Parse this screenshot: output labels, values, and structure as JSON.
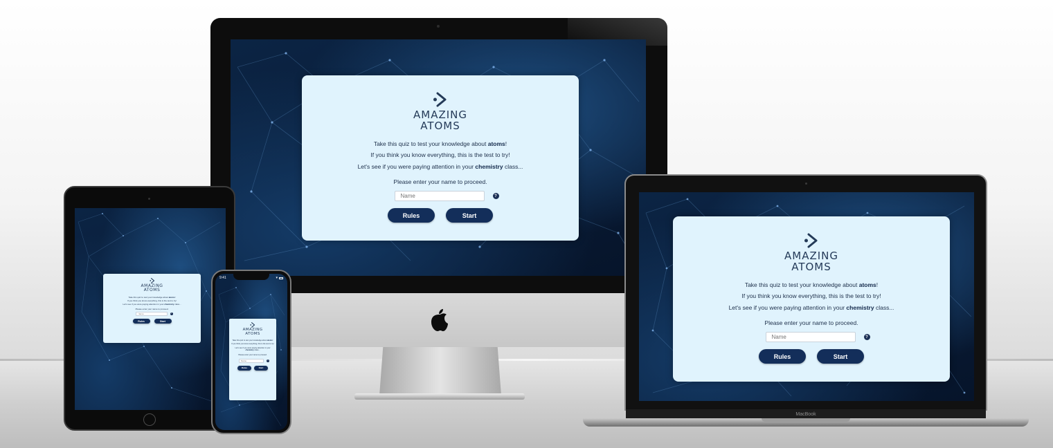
{
  "app": {
    "logo_line1": "AMAZING",
    "logo_line2": "ATOMS",
    "intro_1_before": "Take this quiz to test your knowledge about ",
    "intro_1_bold": "atoms",
    "intro_1_after": "!",
    "intro_2": "If you think you know everything, this is the test to try!",
    "intro_3_before": "Let's see if you were paying attention in your ",
    "intro_3_bold": "chemistry",
    "intro_3_after": " class...",
    "prompt": "Please enter your name to proceed.",
    "name_placeholder": "Name",
    "help_symbol": "?",
    "rules_label": "Rules",
    "start_label": "Start"
  },
  "devices": {
    "laptop_brand": "MacBook",
    "phone_time": "9:41"
  },
  "colors": {
    "card_bg": "#e0f3fd",
    "button_bg": "#132e5a",
    "text": "#1d2f4a",
    "screen_bg": "#0a1d38"
  },
  "icons": [
    "atom-logo-icon",
    "help-icon",
    "apple-logo-icon"
  ]
}
